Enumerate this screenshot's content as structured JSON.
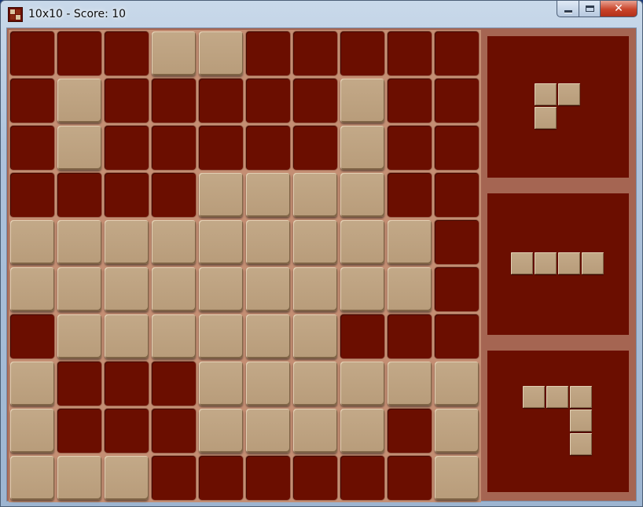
{
  "window": {
    "title": "10x10 - Score: 10",
    "icon": "puzzle-icon",
    "buttons": {
      "minimize": "minimize-icon",
      "maximize": "maximize-icon",
      "close": "close-icon"
    }
  },
  "colors": {
    "empty_cell": "#6b0e00",
    "filled_cell": "#bba080",
    "board_grout": "#c48e73",
    "panel_frame": "#a56552"
  },
  "board": {
    "rows": 10,
    "cols": 10,
    "grid": [
      "0001100000",
      "0100000100",
      "0100000100",
      "0000111100",
      "1111111110",
      "1111111110",
      "0111111000",
      "1000111111",
      "1000111101",
      "1110000001"
    ]
  },
  "pieces": [
    {
      "name": "corner-3",
      "cells": [
        [
          0,
          0
        ],
        [
          0,
          1
        ],
        [
          1,
          0
        ]
      ]
    },
    {
      "name": "bar-4",
      "cells": [
        [
          0,
          0
        ],
        [
          0,
          1
        ],
        [
          0,
          2
        ],
        [
          0,
          3
        ]
      ]
    },
    {
      "name": "corner-5",
      "cells": [
        [
          0,
          0
        ],
        [
          0,
          1
        ],
        [
          0,
          2
        ],
        [
          1,
          2
        ],
        [
          2,
          2
        ]
      ]
    }
  ]
}
